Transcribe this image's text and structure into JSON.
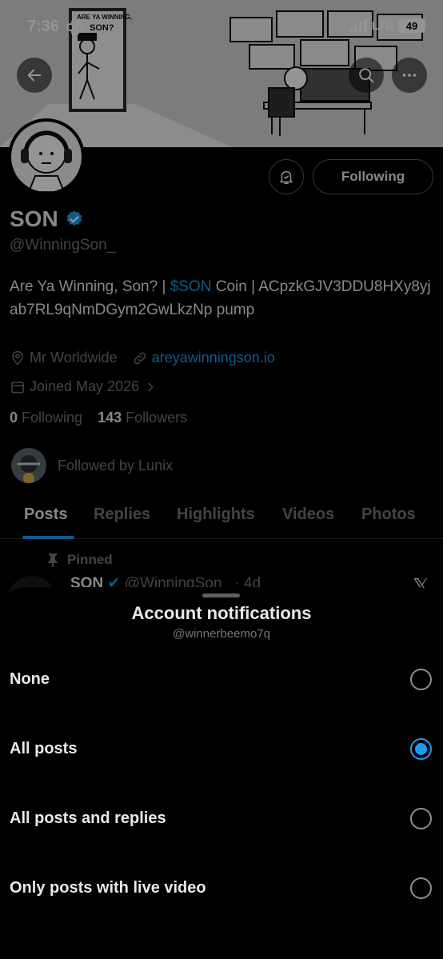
{
  "status_bar": {
    "time": "7:36",
    "network": "LTE",
    "battery": "49"
  },
  "profile": {
    "follow_button_label": "Following",
    "display_name": "SON",
    "handle": "@WinningSon_",
    "bio_prefix": "Are Ya Winning, Son? | ",
    "bio_cashtag": "$SON",
    "bio_suffix": " Coin | ACpzkGJV3DDU8HXy8yjab7RL9qNmDGym2GwLkzNp pump",
    "location": "Mr Worldwide",
    "website": "areyawinningson.io",
    "joined": "Joined May 2026",
    "following_count": "0",
    "following_label": " Following",
    "followers_count": "143",
    "followers_label": " Followers",
    "followed_by": "Followed by Lunix",
    "banner_text_1": "ARE YA WINNING,",
    "banner_text_2": "SON?"
  },
  "tabs": [
    {
      "label": "Posts",
      "active": true
    },
    {
      "label": "Replies",
      "active": false
    },
    {
      "label": "Highlights",
      "active": false
    },
    {
      "label": "Videos",
      "active": false
    },
    {
      "label": "Photos",
      "active": false
    }
  ],
  "pinned_post": {
    "pinned_label": "Pinned",
    "author_name": "SON",
    "author_handle": "@WinningSon_",
    "time": "· 4d",
    "logo_glyph": "𝕏"
  },
  "sheet": {
    "title": "Account notifications",
    "subtitle": "@winnerbeemo7q",
    "options": [
      {
        "label": "None",
        "selected": false
      },
      {
        "label": "All posts",
        "selected": true
      },
      {
        "label": "All posts and replies",
        "selected": false
      },
      {
        "label": "Only posts with live video",
        "selected": false
      }
    ]
  },
  "colors": {
    "accent": "#1d9bf0",
    "text": "#e7e9ea",
    "muted": "#71767b",
    "background": "#000000"
  }
}
